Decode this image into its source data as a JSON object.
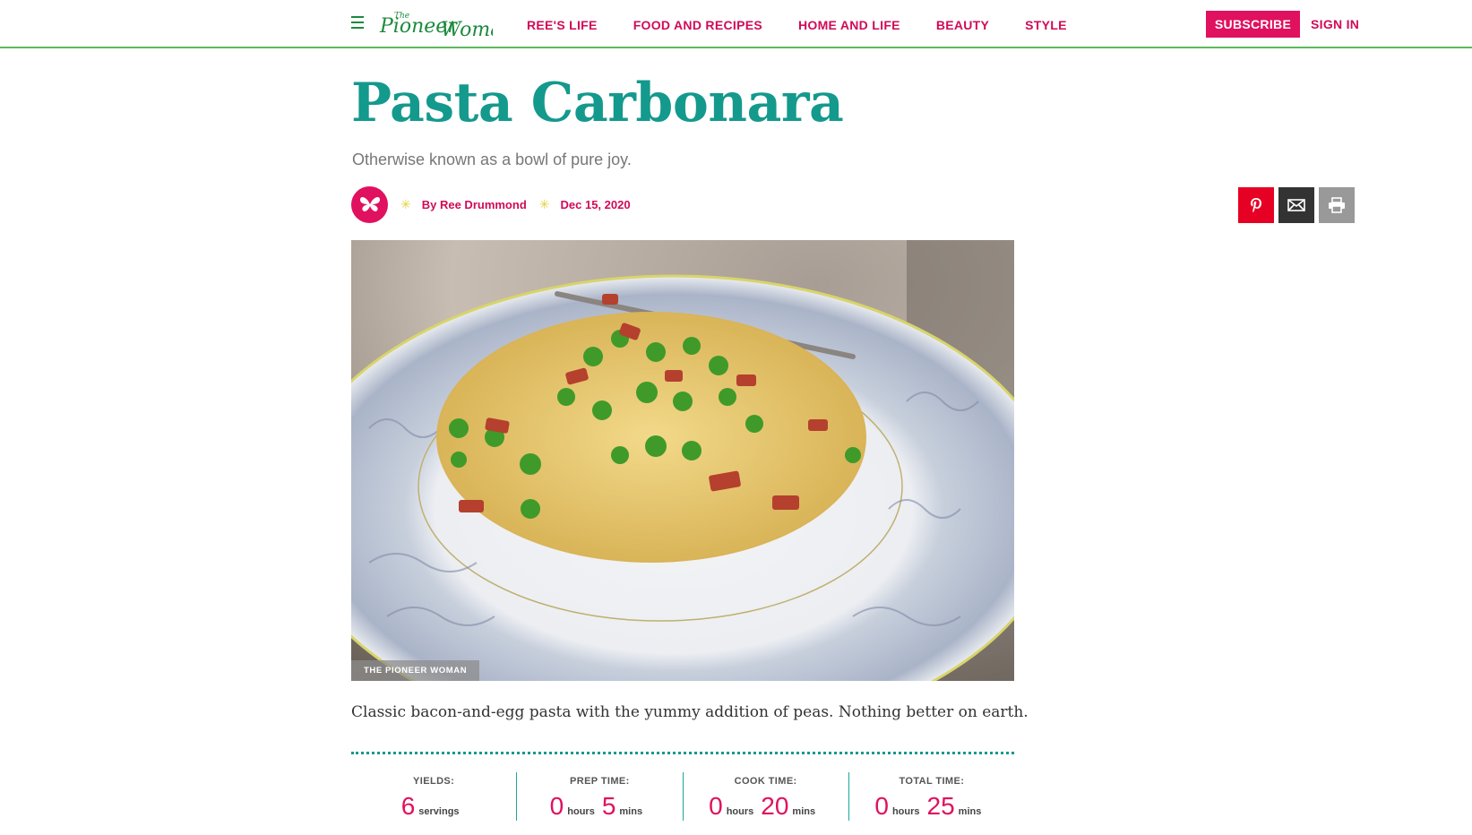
{
  "header": {
    "logo_text": "The Pioneer Woman",
    "nav": [
      "REE'S LIFE",
      "FOOD AND RECIPES",
      "HOME AND LIFE",
      "BEAUTY",
      "STYLE"
    ],
    "subscribe": "SUBSCRIBE",
    "signin": "SIGN IN"
  },
  "article": {
    "title": "Pasta Carbonara",
    "dek": "Otherwise known as a bowl of pure joy.",
    "author": "By Ree Drummond",
    "date": "Dec 15, 2020",
    "image_credit": "THE PIONEER WOMAN",
    "description": "Classic bacon-and-egg pasta with the yummy addition of peas. Nothing better on earth."
  },
  "share": {
    "pinterest": "pinterest-icon",
    "email": "email-icon",
    "print": "print-icon"
  },
  "stats": {
    "yields": {
      "label": "YIELDS:",
      "value": "6",
      "unit": "servings"
    },
    "prep": {
      "label": "PREP TIME:",
      "hours": "0",
      "hours_unit": "hours",
      "mins": "5",
      "mins_unit": "mins"
    },
    "cook": {
      "label": "COOK TIME:",
      "hours": "0",
      "hours_unit": "hours",
      "mins": "20",
      "mins_unit": "mins"
    },
    "total": {
      "label": "TOTAL TIME:",
      "hours": "0",
      "hours_unit": "hours",
      "mins": "25",
      "mins_unit": "mins"
    }
  },
  "colors": {
    "brand_pink": "#e0115f",
    "teal": "#14998d",
    "green_rule": "#5cb85c"
  }
}
